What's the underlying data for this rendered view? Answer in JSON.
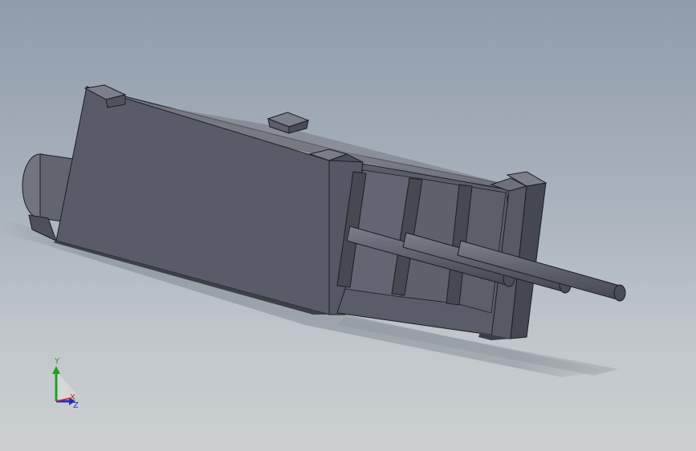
{
  "viewport": {
    "background_top": "#8f9caa",
    "background_bottom": "#cbcfd1",
    "model_color": "#5a5c6a",
    "model_top_color": "#6e707e",
    "model_edge_color": "#1c1c24"
  },
  "triad": {
    "x_label": "X",
    "y_label": "Y",
    "z_label": "Z",
    "x_color": "#d42020",
    "y_color": "#20a020",
    "z_color": "#2030c0"
  }
}
